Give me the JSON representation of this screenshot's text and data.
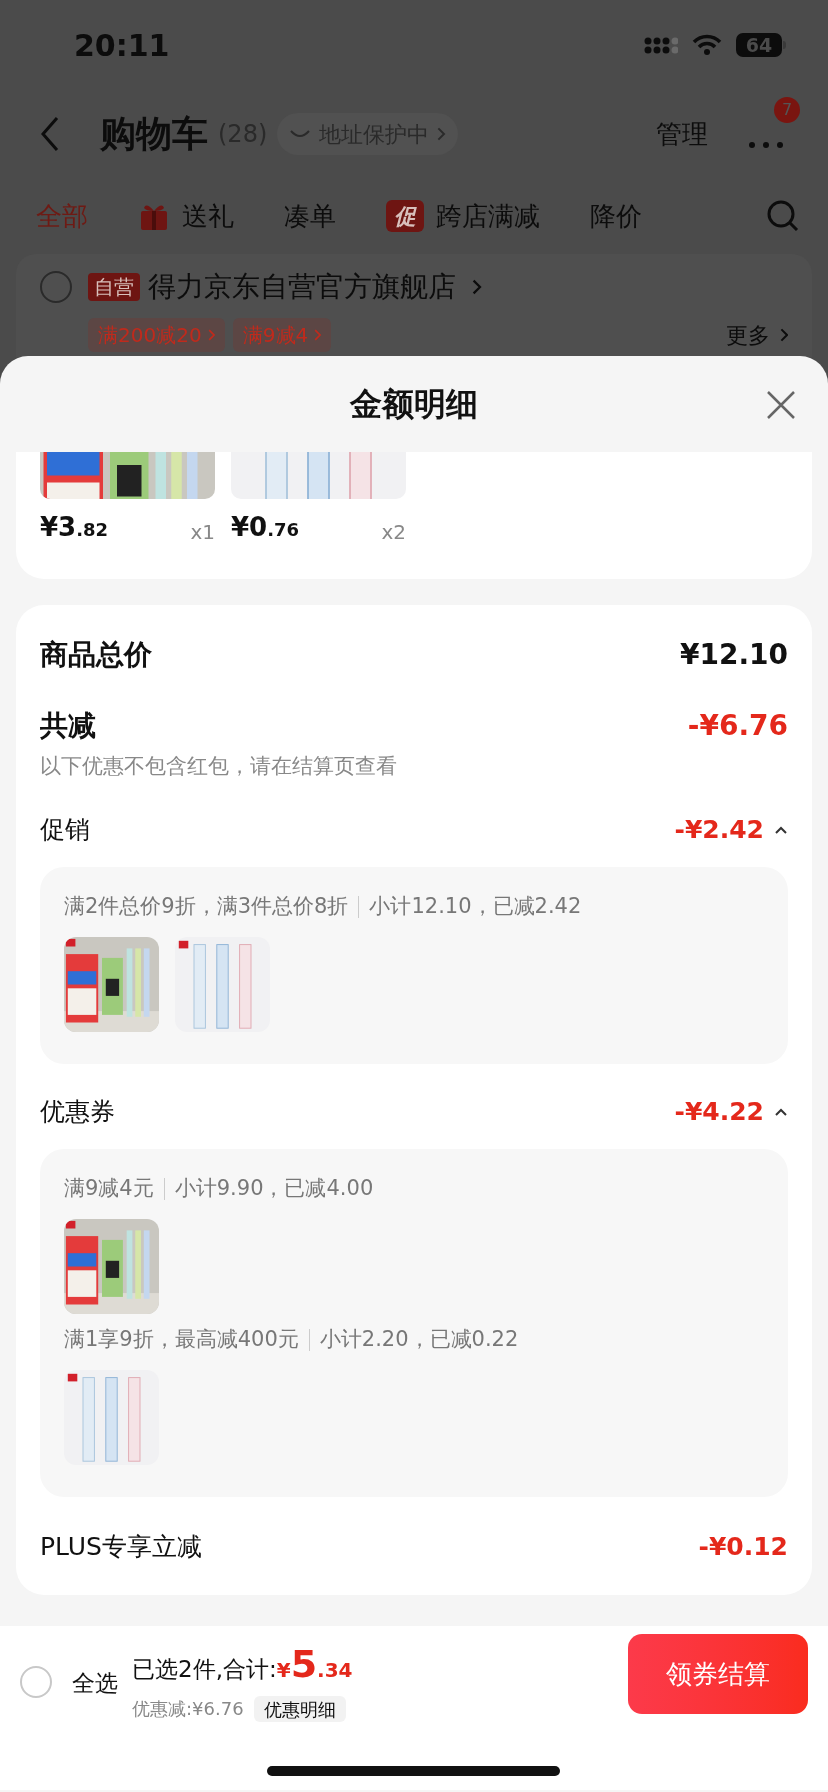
{
  "status_bar": {
    "time": "20:11",
    "battery": "64"
  },
  "header": {
    "title": "购物车",
    "count": "(28)",
    "address_pill": "地址保护中",
    "manage": "管理",
    "more_badge": "7"
  },
  "tabs": [
    {
      "label": "全部",
      "selected": true,
      "kind": "plain"
    },
    {
      "label": "送礼",
      "selected": false,
      "kind": "gift"
    },
    {
      "label": "凑单",
      "selected": false,
      "kind": "plain"
    },
    {
      "label": "跨店满减",
      "selected": false,
      "kind": "badge",
      "badge": "促"
    },
    {
      "label": "降价",
      "selected": false,
      "kind": "plain"
    }
  ],
  "store": {
    "checked": false,
    "badge": "自营",
    "name": "得力京东自营官方旗舰店",
    "tags": [
      "满200减20",
      "满9减4"
    ],
    "more": "更多"
  },
  "sheet": {
    "title": "金额明细",
    "products": [
      {
        "price": "¥3",
        "cents": ".82",
        "qty": "x1"
      },
      {
        "price": "¥0",
        "cents": ".76",
        "qty": "x2"
      }
    ],
    "total_label": "商品总价",
    "total_value": "¥12.10",
    "reduce_label": "共减",
    "reduce_value": "-¥6.76",
    "note": "以下优惠不包含红包，请在结算页查看",
    "sections": [
      {
        "title": "促销",
        "amount": "-¥2.42",
        "expanded": true,
        "groups": [
          {
            "rule": "满2件总价9折，满3件总价8折",
            "subtotal": "小计12.10，已减2.42"
          }
        ]
      },
      {
        "title": "优惠券",
        "amount": "-¥4.22",
        "expanded": true,
        "groups": [
          {
            "rule": "满9减4元",
            "subtotal": "小计9.90，已减4.00"
          },
          {
            "rule": "满1享9折，最高减400元",
            "subtotal": "小计2.20，已减0.22"
          }
        ]
      }
    ],
    "plus_label": "PLUS专享立减",
    "plus_value": "-¥0.12"
  },
  "bottom_bar": {
    "select_all_checked": false,
    "select_all": "全选",
    "selected_text": "已选2件,合计:",
    "currency": "¥",
    "total_int": "5",
    "total_dec": ".34",
    "discount": "优惠减:¥6.76",
    "detail_button": "优惠明细",
    "checkout": "领券结算"
  }
}
